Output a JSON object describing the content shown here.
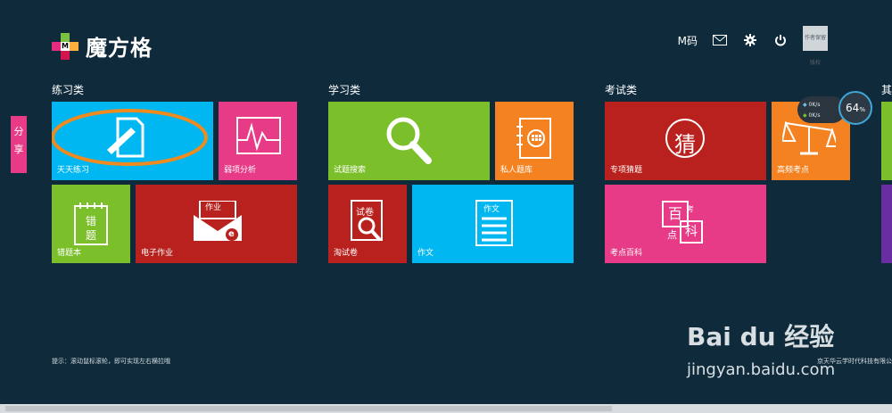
{
  "app": {
    "logo_text": "魔方格",
    "logo_letter": "M",
    "brand_colors": [
      "#7ac143",
      "#e62d7d",
      "#fbb03b",
      "#d3144f"
    ]
  },
  "topbar": {
    "m_code": "M码",
    "message_icon": "envelope",
    "settings_icon": "gear",
    "power_icon": "power",
    "avatar_text": "作者保留版权"
  },
  "share": {
    "label": "分享"
  },
  "sections": {
    "practice": {
      "title": "练习类",
      "tiles": [
        {
          "label": "天天练习",
          "color": "#00b7f1"
        },
        {
          "label": "弱项分析",
          "color": "#e73b87"
        },
        {
          "label": "错题本",
          "color": "#7bbf2a"
        },
        {
          "label": "电子作业",
          "color": "#b8211d",
          "icon_text": "作业",
          "icon_letter": "e"
        }
      ]
    },
    "study": {
      "title": "学习类",
      "tiles": [
        {
          "label": "试题搜索",
          "color": "#7bbf2a"
        },
        {
          "label": "私人题库",
          "color": "#f58220"
        },
        {
          "label": "淘试卷",
          "color": "#b8211d",
          "icon_text": "试卷"
        },
        {
          "label": "作文",
          "color": "#00b7f1",
          "icon_text": "作文"
        }
      ]
    },
    "exam": {
      "title": "考试类",
      "tiles": [
        {
          "label": "专项猜题",
          "color": "#b8211d",
          "icon_text": "猜"
        },
        {
          "label": "高频考点",
          "color": "#f58220"
        },
        {
          "label": "考点百科",
          "color": "#e73b87",
          "icon_text_1": "百",
          "icon_text_2": "考",
          "icon_text_3": "点",
          "icon_text_4": "科"
        }
      ]
    },
    "other": {
      "title": "其"
    }
  },
  "speed_widget": {
    "upload": "0K/s",
    "download": "0K/s",
    "percent": "64",
    "percent_unit": "%"
  },
  "hint": {
    "text": "提示：滚动鼠标滚轮，即可实现左右横拉哦"
  },
  "footer": {
    "company": "京天华云学时代科技有限公"
  },
  "watermark": {
    "brand": "Bai du 经验",
    "url": "jingyan.baidu.com"
  }
}
